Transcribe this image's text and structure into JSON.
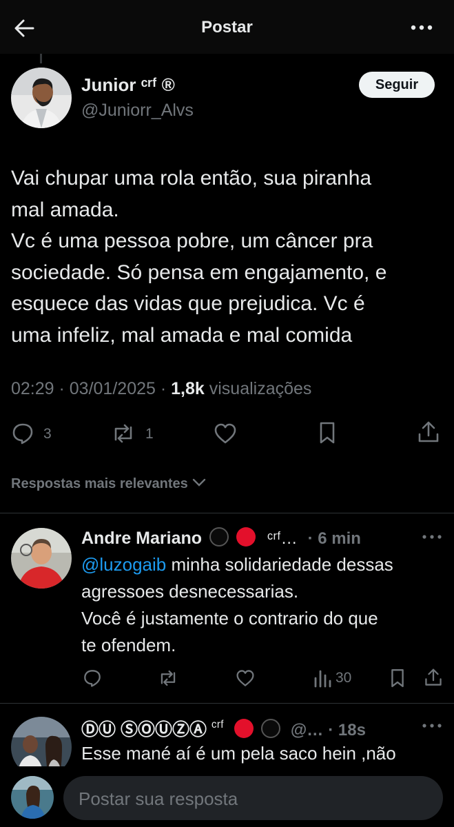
{
  "header": {
    "title": "Postar"
  },
  "tweet": {
    "author_name": "Junior ᶜʳᶠ ®",
    "author_handle": "@Juniorr_Alvs",
    "follow_label": "Seguir",
    "text": "Vai chupar uma rola então, sua piranha\nmal amada.\nVc é uma pessoa pobre, um câncer pra\nsociedade. Só pensa em engajamento, e\nesquece das vidas que prejudica. Vc é\numa infeliz, mal amada e mal comida",
    "time": "02:29 · 03/01/2025 · ",
    "views_count": "1,8k",
    "views_label": " visualizações",
    "replies": "3",
    "reposts": "1"
  },
  "sort_label": "Respostas mais relevantes",
  "replies": [
    {
      "name": "Andre Mariano",
      "badges": "ᶜʳᶠ…",
      "time": "· 6 min",
      "mention": "@luzogaib",
      "text_after_mention": " minha solidariedade dessas\nagressoes desnecessarias.\nVocê é justamente o contrario do que\nte ofendem.",
      "views": "30"
    },
    {
      "name": "ⒹⓊ ⓈⓄⓊⓏⒶ",
      "badges": "ᶜʳᶠ",
      "handle": "@…",
      "time": "· 18s",
      "text": "Esse mané aí é um pela saco hein ,não"
    }
  ],
  "composer": {
    "placeholder": "Postar sua resposta"
  },
  "colors": {
    "accent": "#1d9bf0",
    "muted": "#71767b",
    "background": "#000000"
  }
}
